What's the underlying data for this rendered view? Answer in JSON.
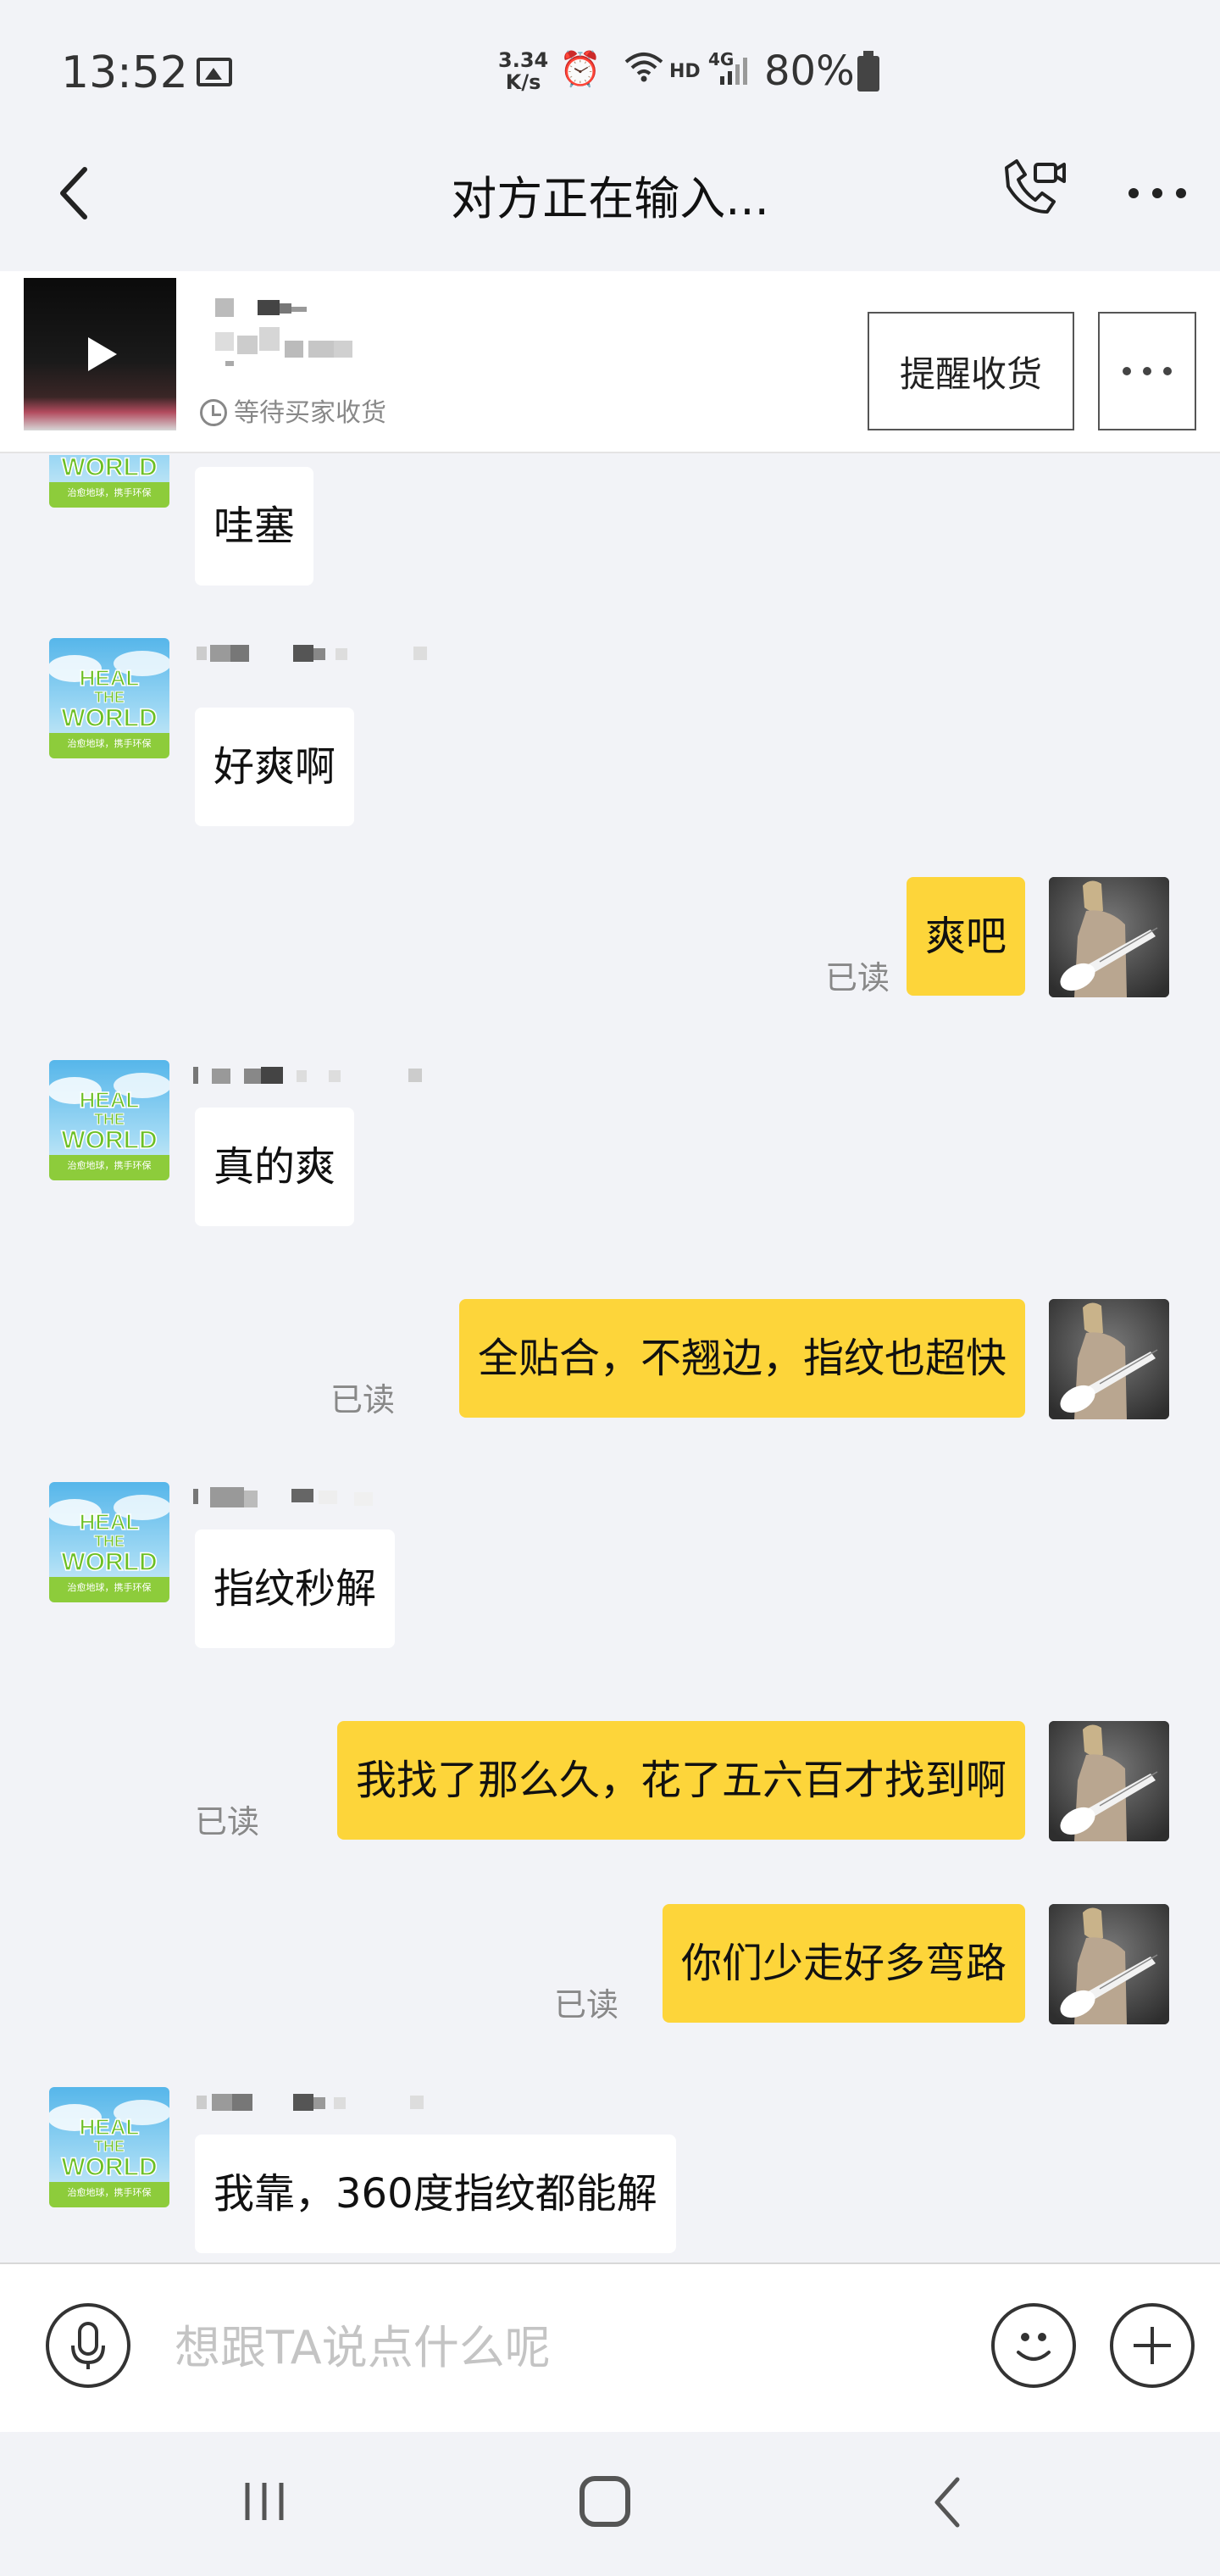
{
  "status_bar": {
    "time": "13:52",
    "net_speed_value": "3.34",
    "net_speed_unit": "K/s",
    "hd": "HD",
    "network": "4G",
    "battery": "80%"
  },
  "nav": {
    "title": "对方正在输入..."
  },
  "order": {
    "status": "等待买家收货",
    "remind_button": "提醒收货"
  },
  "avatar_badge": {
    "line1": "HEAL",
    "line2": "THE",
    "line3": "WORLD",
    "caption": "治愈地球，携手环保"
  },
  "messages": [
    {
      "side": "in",
      "text": "哇塞",
      "read": ""
    },
    {
      "side": "in",
      "text": "好爽啊",
      "read": ""
    },
    {
      "side": "out",
      "text": "爽吧",
      "read": "已读"
    },
    {
      "side": "in",
      "text": "真的爽",
      "read": ""
    },
    {
      "side": "out",
      "text": "全贴合，不翘边，指纹也超快",
      "read": "已读"
    },
    {
      "side": "in",
      "text": "指纹秒解",
      "read": ""
    },
    {
      "side": "out",
      "text": "我找了那么久，花了五六百才找到啊",
      "read": "已读"
    },
    {
      "side": "out",
      "text": "你们少走好多弯路",
      "read": "已读"
    },
    {
      "side": "in",
      "text": "我靠，360度指纹都能解",
      "read": ""
    }
  ],
  "input": {
    "placeholder": "想跟TA说点什么呢"
  },
  "colors": {
    "bg": "#f2f3f7",
    "bubble_out": "#fdd53a",
    "bubble_in": "#ffffff",
    "read_text": "#888888"
  }
}
